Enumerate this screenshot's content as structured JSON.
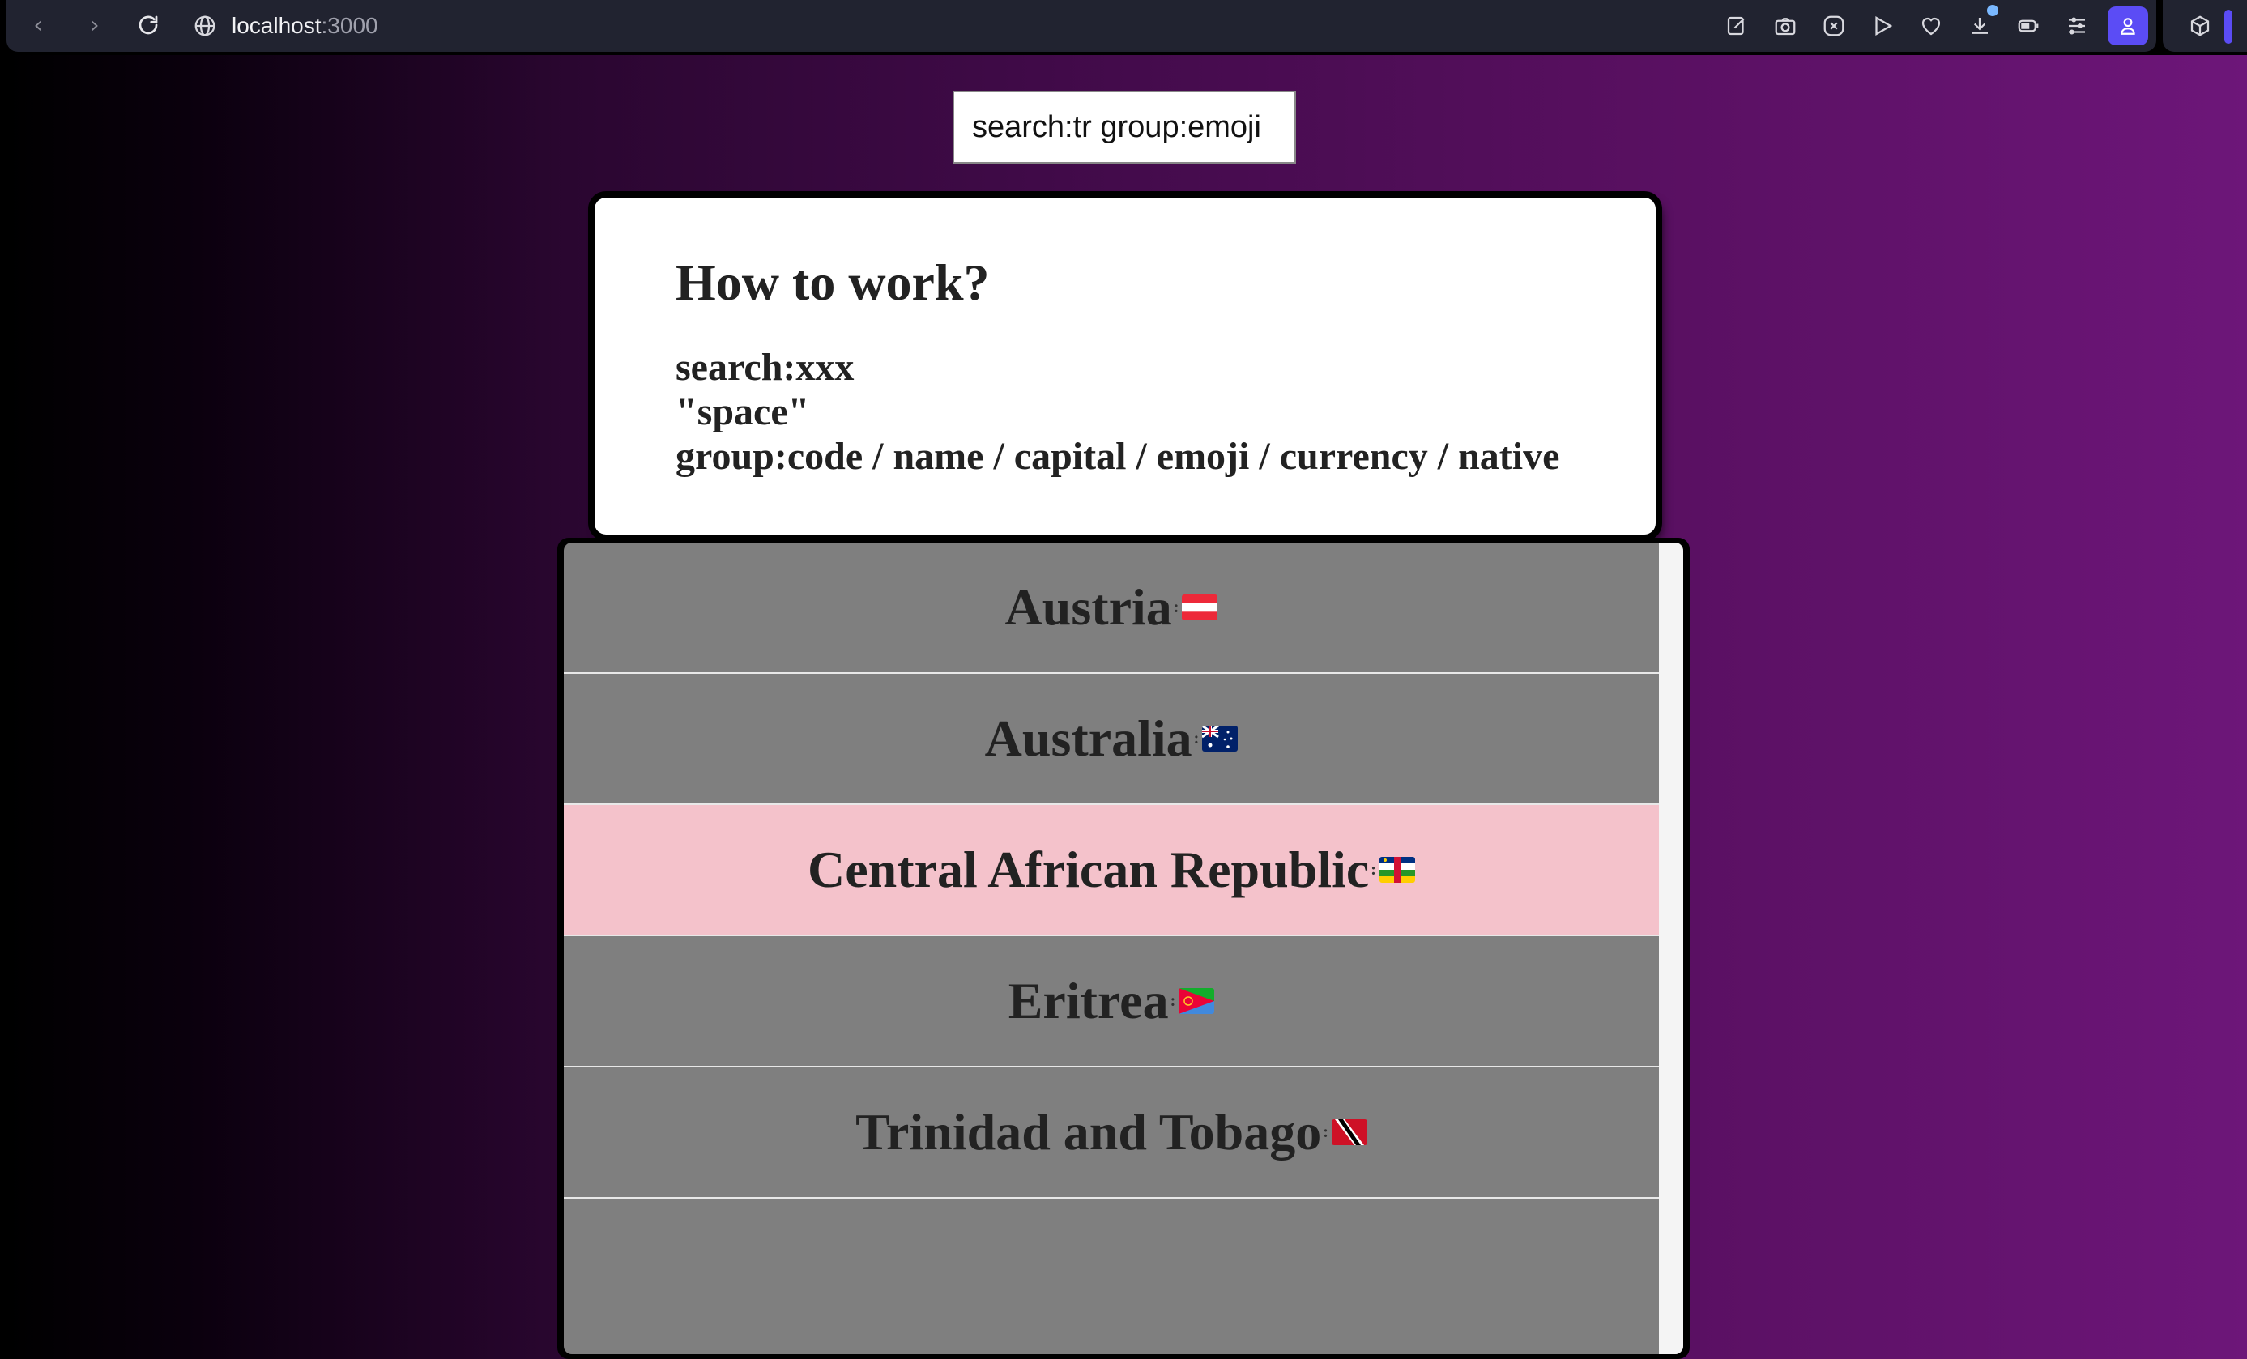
{
  "browser": {
    "url_host": "localhost",
    "url_port": ":3000",
    "nav_icons": [
      "back-icon",
      "forward-icon",
      "reload-icon",
      "globe-icon"
    ],
    "extension_icons": [
      "edit-icon",
      "camera-icon",
      "close-circle-icon",
      "play-icon",
      "heart-icon",
      "download-icon",
      "battery-icon",
      "sliders-icon",
      "profile-icon",
      "cube-icon"
    ],
    "accent": "#5b4cf5"
  },
  "search": {
    "value": "search:tr group:emoji"
  },
  "help": {
    "title": "How to work?",
    "line1": "search:xxx",
    "line2": "\"space\"",
    "line3": "group:code / name / capital / emoji / currency / native"
  },
  "results": [
    {
      "name": "Austria",
      "sep": ":",
      "flag": "flag-austria-icon"
    },
    {
      "name": "Australia",
      "sep": ":",
      "flag": "flag-australia-icon"
    },
    {
      "name": "Central African Republic",
      "sep": ":",
      "flag": "flag-central-african-republic-icon",
      "highlighted": true
    },
    {
      "name": "Eritrea",
      "sep": ":",
      "flag": "flag-eritrea-icon"
    },
    {
      "name": "Trinidad and Tobago",
      "sep": ":",
      "flag": "flag-trinidad-and-tobago-icon"
    }
  ],
  "colors": {
    "row_bg": "#7f7f7f",
    "row_highlight": "#f4c2cb",
    "gradient_end": "#6d1679"
  }
}
